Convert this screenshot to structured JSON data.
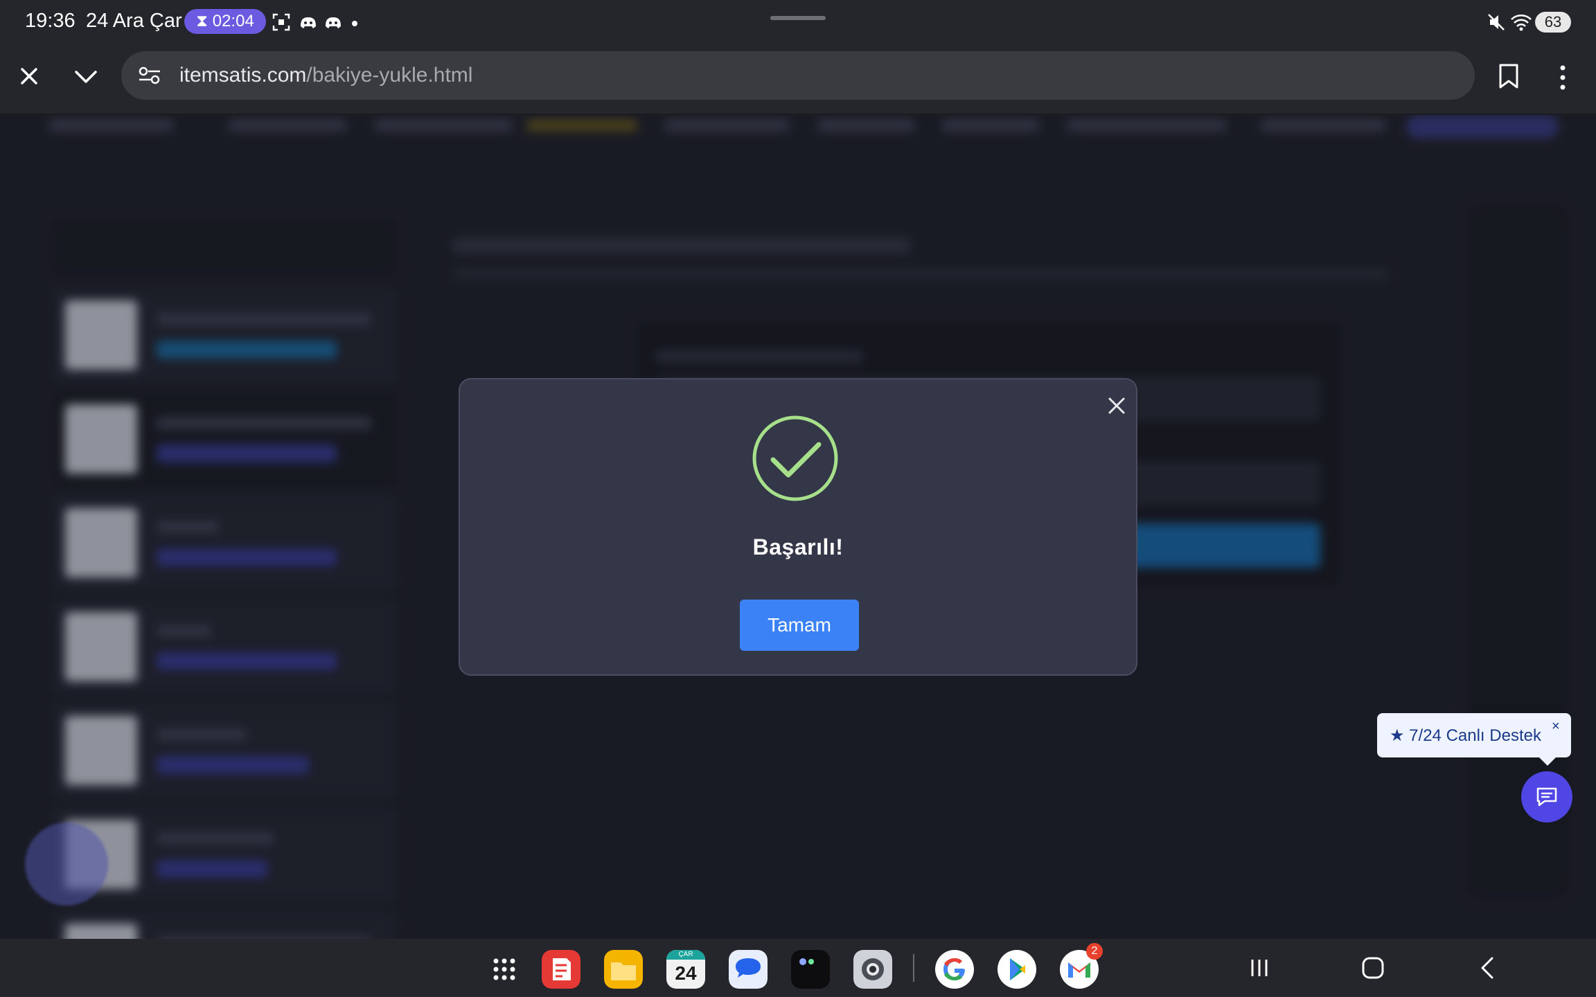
{
  "status_bar": {
    "time": "19:36",
    "date": "24 Ara Çar",
    "timer": "02:04",
    "battery": "63"
  },
  "browser": {
    "url_host": "itemsatis.com",
    "url_path": "/bakiye-yukle.html"
  },
  "modal": {
    "title": "Başarılı!",
    "ok_label": "Tamam",
    "icon": "check-circle-icon",
    "accent_color": "#a6e08a",
    "button_color": "#3b82f6"
  },
  "support": {
    "tooltip": "★ 7/24 Canlı Destek",
    "close_glyph": "×"
  },
  "dock": {
    "calendar_day_label": "ÇAR",
    "calendar_day": "24",
    "gmail_badge": "2",
    "apps": [
      "apps-grid-icon",
      "notes-app-icon",
      "files-app-icon",
      "calendar-app-icon",
      "messages-app-icon",
      "camera-app-icon",
      "chrome-app-icon",
      "google-app-icon",
      "play-store-app-icon",
      "gmail-app-icon"
    ]
  }
}
